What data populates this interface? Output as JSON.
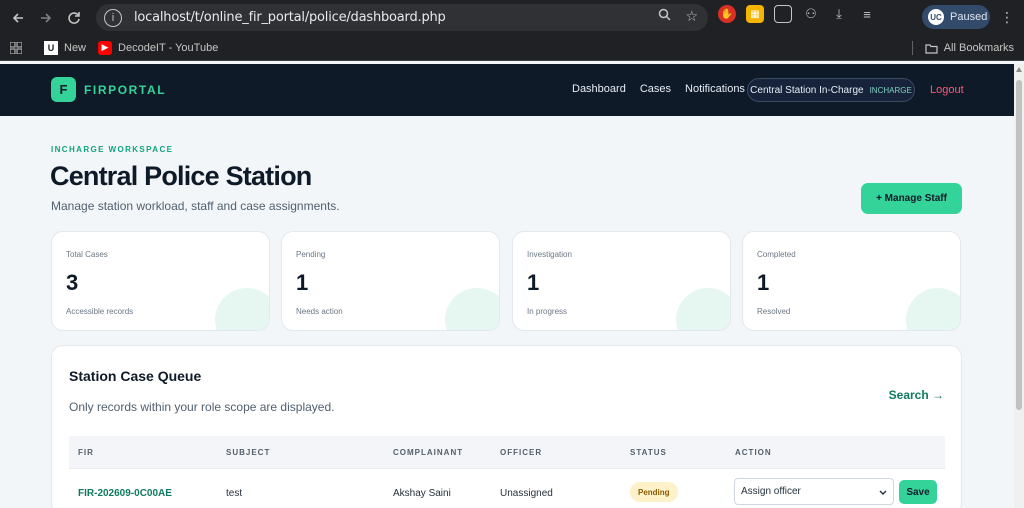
{
  "browser": {
    "url": "localhost/t/online_fir_portal/police/dashboard.php",
    "profile_label": "Paused",
    "bookmarks": [
      {
        "label": "New",
        "icon": "uc-favicon"
      },
      {
        "label": "DecodeIT - YouTube",
        "icon": "youtube-icon"
      }
    ],
    "all_bookmarks_label": "All Bookmarks"
  },
  "app": {
    "logo_letter": "F",
    "brand": "FIRPORTAL",
    "nav": [
      "Dashboard",
      "Cases",
      "Notifications"
    ],
    "role_name": "Central Station In-Charge",
    "role_tag": "INCHARGE",
    "logout": "Logout"
  },
  "page": {
    "kicker": "INCHARGE WORKSPACE",
    "title": "Central Police Station",
    "subtitle": "Manage station workload, staff and case assignments.",
    "manage_button": "+ Manage Staff"
  },
  "stats": [
    {
      "label": "Total Cases",
      "value": "3",
      "note": "Accessible records"
    },
    {
      "label": "Pending",
      "value": "1",
      "note": "Needs action"
    },
    {
      "label": "Investigation",
      "value": "1",
      "note": "In progress"
    },
    {
      "label": "Completed",
      "value": "1",
      "note": "Resolved"
    }
  ],
  "queue": {
    "title": "Station Case Queue",
    "subtitle": "Only records within your role scope are displayed.",
    "search_link": "Search →",
    "columns": [
      "FIR",
      "SUBJECT",
      "COMPLAINANT",
      "OFFICER",
      "STATUS",
      "ACTION"
    ],
    "rows": [
      {
        "fir": "FIR-202609-0C00AE",
        "subject": "test",
        "complainant": "Akshay Saini",
        "officer": "Unassigned",
        "status": "Pending",
        "action_select": "Assign officer",
        "action_button": "Save"
      }
    ]
  },
  "colors": {
    "accent": "#34d399",
    "header_bg": "#0f1a29",
    "logout": "#ff5a72",
    "pending_badge": "#fdf1c9"
  }
}
